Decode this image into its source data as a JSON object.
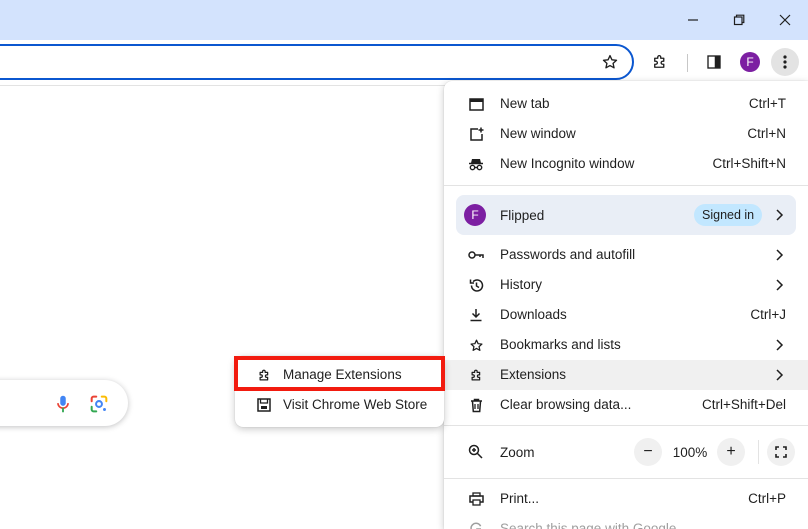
{
  "window": {
    "controls": [
      "minimize-icon",
      "restore-icon",
      "close-icon"
    ]
  },
  "toolbar": {
    "avatar_initial": "F",
    "icons": [
      "bookmark-star-icon",
      "extensions-puzzle-icon",
      "side-panel-icon",
      "profile-avatar",
      "more-vert-icon"
    ]
  },
  "page": {
    "searchbox_icons": [
      "voice-search-icon",
      "google-lens-icon"
    ]
  },
  "menu": {
    "items_top": [
      {
        "label": "New tab",
        "shortcut": "Ctrl+T",
        "icon": "new-tab-icon"
      },
      {
        "label": "New window",
        "shortcut": "Ctrl+N",
        "icon": "new-window-icon"
      },
      {
        "label": "New Incognito window",
        "shortcut": "Ctrl+Shift+N",
        "icon": "incognito-icon"
      }
    ],
    "profile": {
      "initial": "F",
      "name": "Flipped",
      "status": "Signed in"
    },
    "items_mid": [
      {
        "label": "Passwords and autofill",
        "shortcut": "",
        "icon": "key-icon",
        "submenu": true
      },
      {
        "label": "History",
        "shortcut": "",
        "icon": "history-icon",
        "submenu": true
      },
      {
        "label": "Downloads",
        "shortcut": "Ctrl+J",
        "icon": "download-icon"
      },
      {
        "label": "Bookmarks and lists",
        "shortcut": "",
        "icon": "star-icon",
        "submenu": true
      },
      {
        "label": "Extensions",
        "shortcut": "",
        "icon": "extensions-icon",
        "submenu": true
      },
      {
        "label": "Clear browsing data...",
        "shortcut": "Ctrl+Shift+Del",
        "icon": "trash-icon"
      }
    ],
    "zoom": {
      "label": "Zoom",
      "value": "100%",
      "minus": "−",
      "plus": "+"
    },
    "items_bottom": [
      {
        "label": "Print...",
        "shortcut": "Ctrl+P",
        "icon": "print-icon"
      },
      {
        "label": "Search this page with Google",
        "shortcut": "",
        "icon": "google-g-icon"
      }
    ]
  },
  "submenu": {
    "items": [
      {
        "label": "Manage Extensions",
        "icon": "extensions-icon"
      },
      {
        "label": "Visit Chrome Web Store",
        "icon": "web-store-icon"
      }
    ],
    "highlight_color": "#f21b0f"
  },
  "colors": {
    "titlebar": "#d3e3fd",
    "omnibox_border": "#0b57d0",
    "avatar": "#7c1fa2",
    "profile_bg": "#e9eef6",
    "badge_bg": "#c2e7ff"
  }
}
